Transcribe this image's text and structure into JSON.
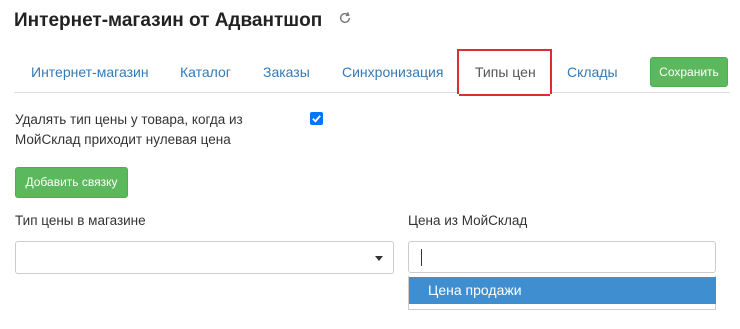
{
  "page": {
    "title": "Интернет-магазин от Адвантшоп"
  },
  "tabs": [
    {
      "label": "Интернет-магазин"
    },
    {
      "label": "Каталог"
    },
    {
      "label": "Заказы"
    },
    {
      "label": "Синхронизация"
    },
    {
      "label": "Типы цен",
      "active": true
    },
    {
      "label": "Склады"
    }
  ],
  "toolbar": {
    "save_label": "Сохранить"
  },
  "settings": {
    "zero_price_label": "Удалять тип цены у товара, когда из МойСклад приходит нулевая цена",
    "zero_price_checked": true
  },
  "actions": {
    "add_binding_label": "Добавить связку"
  },
  "mapping": {
    "store_price_type_label": "Тип цены в магазине",
    "store_price_type_value": "",
    "moysklad_price_label": "Цена из МойСклад",
    "moysklad_price_search_value": "",
    "options": [
      {
        "label": "Цена продажи",
        "highlighted": true
      }
    ]
  },
  "colors": {
    "link": "#337ab7",
    "success": "#5cb85c",
    "highlight_border": "#d9302d",
    "option_active": "#3e8ed0",
    "checkbox": "#0075ff"
  },
  "icons": {
    "refresh": "refresh-icon",
    "caret": "chevron-down-icon",
    "check": "check-icon"
  }
}
